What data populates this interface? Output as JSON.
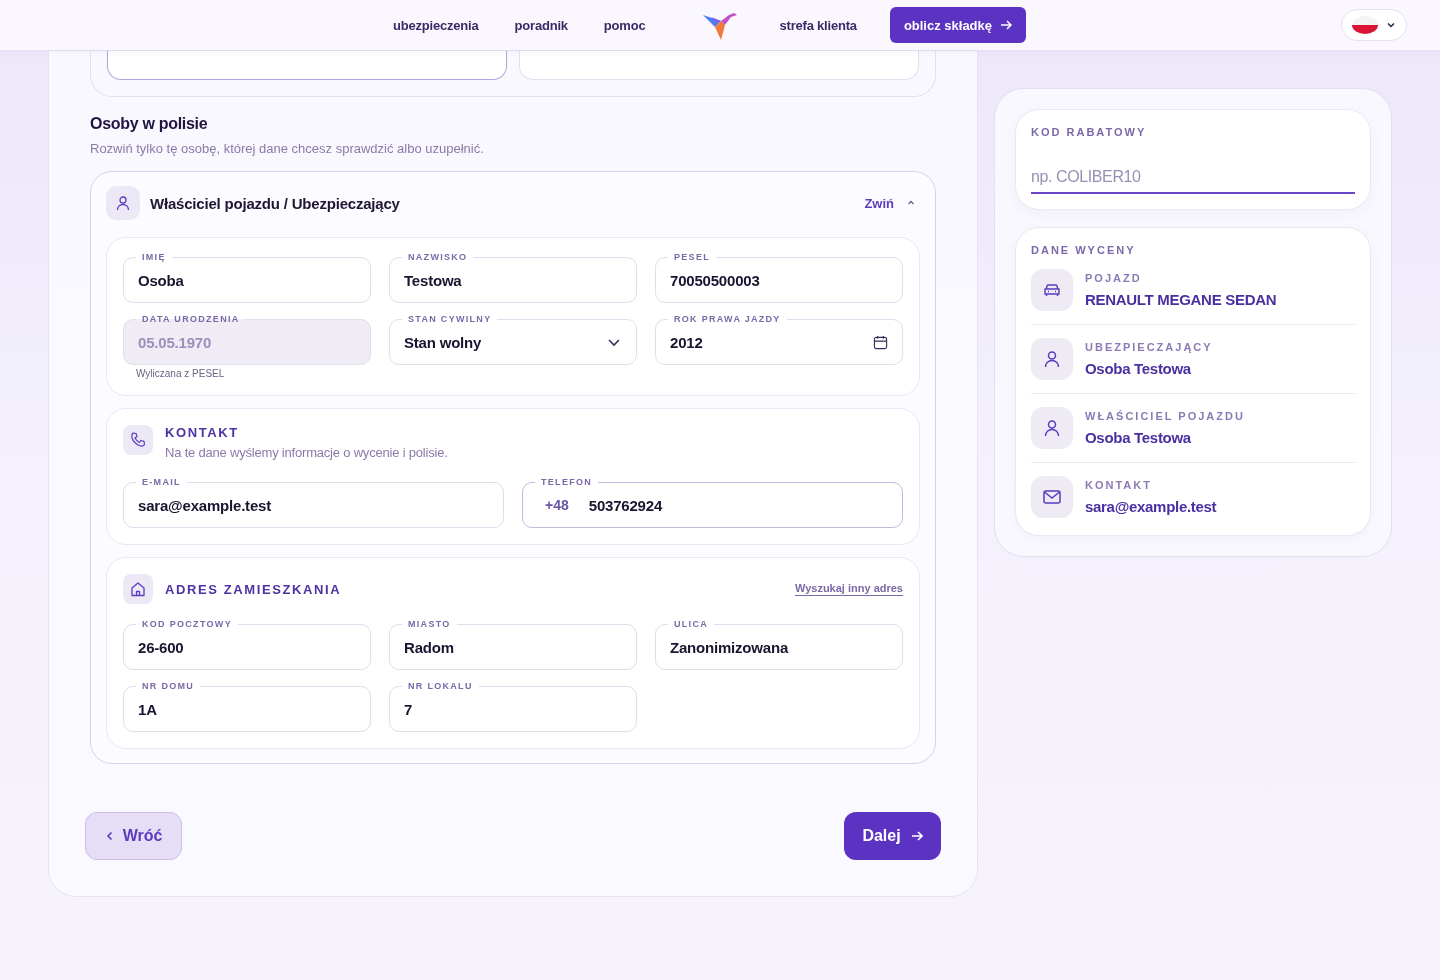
{
  "nav": {
    "links": [
      {
        "label": "ubezpieczenia"
      },
      {
        "label": "poradnik"
      },
      {
        "label": "pomoc"
      }
    ],
    "client_link": "strefa klienta",
    "cta": "oblicz składkę"
  },
  "persons": {
    "title": "Osoby w polisie",
    "subtitle": "Rozwiń tylko tę osobę, której dane chcesz sprawdzić albo uzupełnić.",
    "card": {
      "title": "Właściciel pojazdu / Ubezpieczający",
      "toggle": "Zwiń",
      "expanded": true,
      "personal": [
        {
          "kind": "text",
          "label": "IMIĘ",
          "value": "Osoba",
          "disabled": false
        },
        {
          "kind": "text",
          "label": "NAZWISKO",
          "value": "Testowa",
          "disabled": false
        },
        {
          "kind": "text",
          "label": "PESEL",
          "value": "70050500003",
          "disabled": false
        },
        {
          "kind": "text",
          "label": "DATA URODZENIA",
          "value": "05.05.1970",
          "disabled": true,
          "hint": "Wyliczana z PESEL"
        },
        {
          "kind": "select",
          "label": "STAN CYWILNY",
          "value": "Stan wolny",
          "disabled": false
        },
        {
          "kind": "date",
          "label": "ROK PRAWA JAZDY",
          "value": "2012",
          "disabled": false
        }
      ],
      "contact": {
        "title": "KONTAKT",
        "subtitle": "Na te dane wyślemy informacje o wycenie i polisie.",
        "fields": [
          {
            "kind": "text",
            "label": "E-MAIL",
            "value": "sara@example.test",
            "disabled": false
          },
          {
            "kind": "phone",
            "label": "TELEFON",
            "prefix": "+48",
            "value": "503762924",
            "disabled": false
          }
        ]
      },
      "address": {
        "title": "ADRES ZAMIESZKANIA",
        "link": "Wyszukaj inny adres",
        "fields": [
          {
            "label": "KOD POCZTOWY",
            "value": "26-600",
            "disabled": false
          },
          {
            "label": "MIASTO",
            "value": "Radom",
            "disabled": false
          },
          {
            "label": "ULICA",
            "value": "Zanonimizowana",
            "disabled": false
          },
          {
            "label": "NR DOMU",
            "value": "1A",
            "disabled": false
          },
          {
            "label": "NR LOKALU",
            "value": "7",
            "disabled": false
          }
        ]
      }
    }
  },
  "buttons": {
    "back": "Wróć",
    "next": "Dalej"
  },
  "discount": {
    "label": "KOD RABATOWY",
    "placeholder": "np. COLIBER10"
  },
  "summary": {
    "title": "DANE WYCENY",
    "items": [
      {
        "kind": "car",
        "label": "POJAZD",
        "value": "RENAULT MEGANE SEDAN"
      },
      {
        "kind": "person",
        "label": "UBEZPIECZAJĄCY",
        "value": "Osoba Testowa"
      },
      {
        "kind": "person",
        "label": "WŁAŚCICIEL POJAZDU",
        "value": "Osoba Testowa"
      },
      {
        "kind": "mail",
        "label": "KONTAKT",
        "value": "sara@example.test"
      }
    ]
  }
}
